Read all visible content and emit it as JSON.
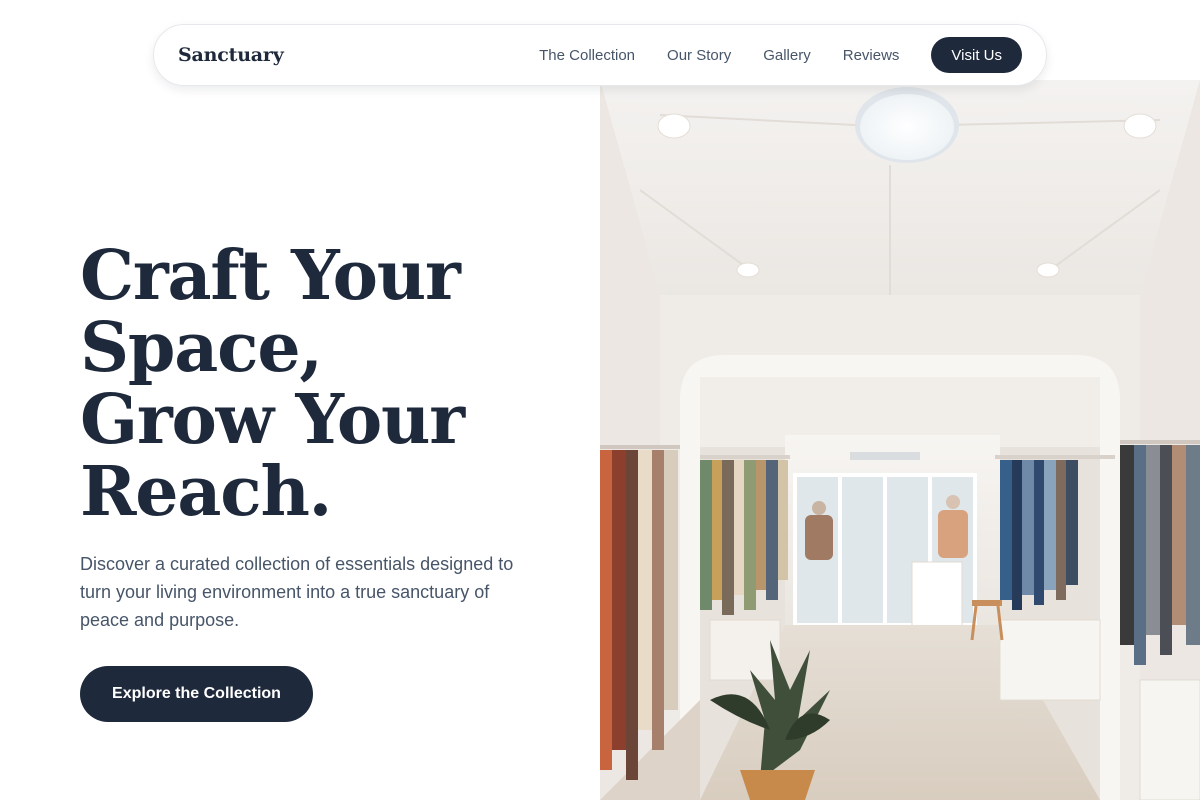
{
  "brand": {
    "name": "Sanctuary"
  },
  "nav": {
    "links": [
      "The Collection",
      "Our Story",
      "Gallery",
      "Reviews"
    ],
    "cta_label": "Visit Us"
  },
  "hero": {
    "title_lines": [
      "Craft Your",
      "Space,",
      "Grow Your",
      "Reach."
    ],
    "subtitle": "Discover a curated collection of essentials designed to turn your living environment into a true sanctuary of peace and purpose.",
    "cta_label": "Explore the Collection"
  },
  "colors": {
    "primary": "#1e293b",
    "text_muted": "#475569",
    "background": "#ffffff"
  }
}
